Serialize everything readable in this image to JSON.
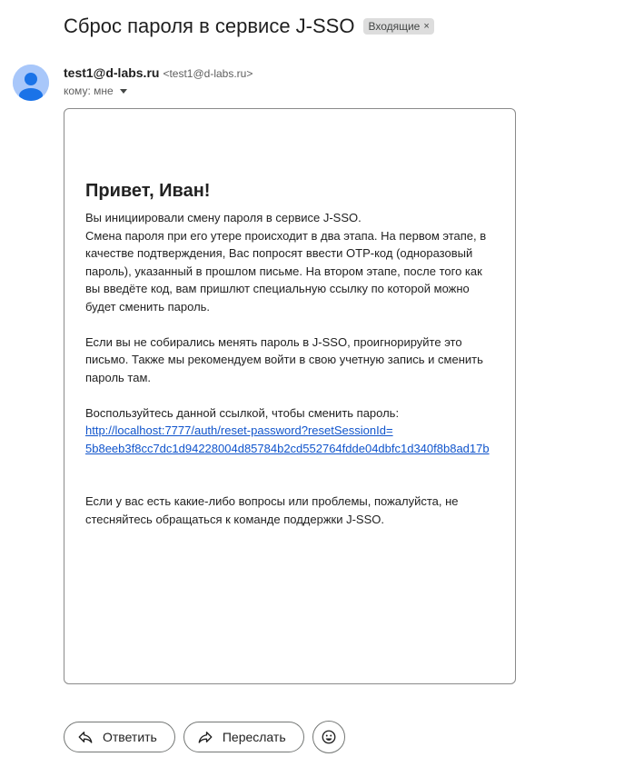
{
  "email": {
    "subject": "Сброс пароля в сервисе J-SSO",
    "label": "Входящие",
    "label_close": "×",
    "sender_name": "test1@d-labs.ru",
    "sender_email": "<test1@d-labs.ru>",
    "to_label": "кому: мне"
  },
  "body": {
    "greeting": "Привет, Иван!",
    "p1": "Вы инициировали смену пароля в сервисе J-SSO.",
    "p2_l1": "Смена пароля при его утере происходит в два этапа. На первом этапе, в",
    "p2_l2": "качестве подтверждения, Вас попросят ввести OTP-код (одноразовый",
    "p2_l3": "пароль), указанный в прошлом письме. На втором этапе, после того как",
    "p2_l4": "вы введёте код, вам пришлют специальную ссылку по которой можно",
    "p2_l5": "будет сменить пароль.",
    "p3_l1": "Если вы не собирались менять пароль в J-SSO, проигнорируйте это",
    "p3_l2": "письмо. Также мы рекомендуем войти в свою учетную запись и сменить",
    "p3_l3": "пароль там.",
    "p4": "Воспользуйтесь данной ссылкой, чтобы сменить пароль:",
    "link_l1": "http://localhost:7777/auth/reset-password?resetSessionId=",
    "link_l2": "5b8eeb3f8cc7dc1d94228004d85784b2cd552764fdde04dbfc1d340f8b8ad17b",
    "p5_l1": "Если у вас есть какие-либо вопросы или проблемы, пожалуйста, не",
    "p5_l2": "стесняйтесь обращаться к команде поддержки J-SSO."
  },
  "actions": {
    "reply_label": "Ответить",
    "forward_label": "Переслать",
    "reply_icon": "reply-icon",
    "forward_icon": "forward-icon",
    "emoji_icon": "emoji-icon"
  },
  "colors": {
    "link": "#1155cc",
    "avatar_bg": "#a8c7fa",
    "avatar_fg": "#1a73e8",
    "chip_bg": "#dddddd"
  }
}
